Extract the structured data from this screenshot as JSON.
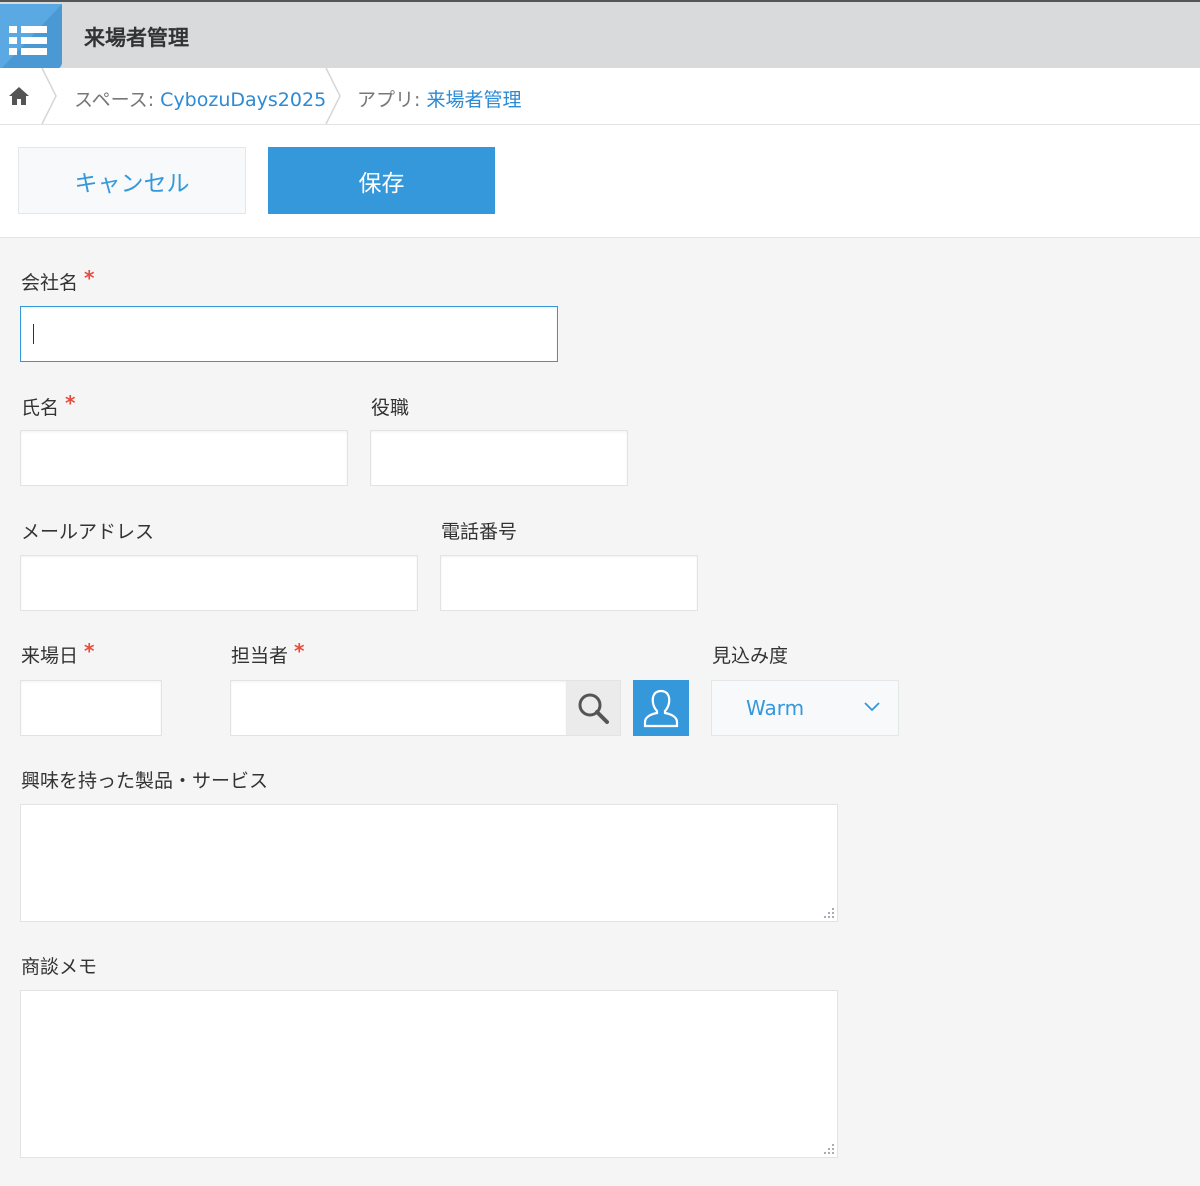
{
  "header": {
    "app_title": "来場者管理"
  },
  "breadcrumb": {
    "space_prefix": "スペース: ",
    "space_name": "CybozuDays2025",
    "app_prefix": "アプリ: ",
    "app_name": "来場者管理"
  },
  "toolbar": {
    "cancel_label": "キャンセル",
    "save_label": "保存"
  },
  "form": {
    "company": {
      "label": "会社名",
      "required_mark": "*",
      "value": ""
    },
    "name": {
      "label": "氏名",
      "required_mark": "*",
      "value": ""
    },
    "title": {
      "label": "役職",
      "value": ""
    },
    "email": {
      "label": "メールアドレス",
      "value": ""
    },
    "phone": {
      "label": "電話番号",
      "value": ""
    },
    "visit_date": {
      "label": "来場日",
      "required_mark": "*",
      "value": ""
    },
    "assignee": {
      "label": "担当者",
      "required_mark": "*",
      "value": ""
    },
    "prospect": {
      "label": "見込み度",
      "selected": "Warm"
    },
    "interest": {
      "label": "興味を持った製品・サービス",
      "value": ""
    },
    "memo": {
      "label": "商談メモ",
      "value": ""
    }
  },
  "colors": {
    "accent": "#3498db",
    "required": "#e74c3c",
    "header_bg": "#d8dadb",
    "app_icon": "#5aa9e2"
  }
}
